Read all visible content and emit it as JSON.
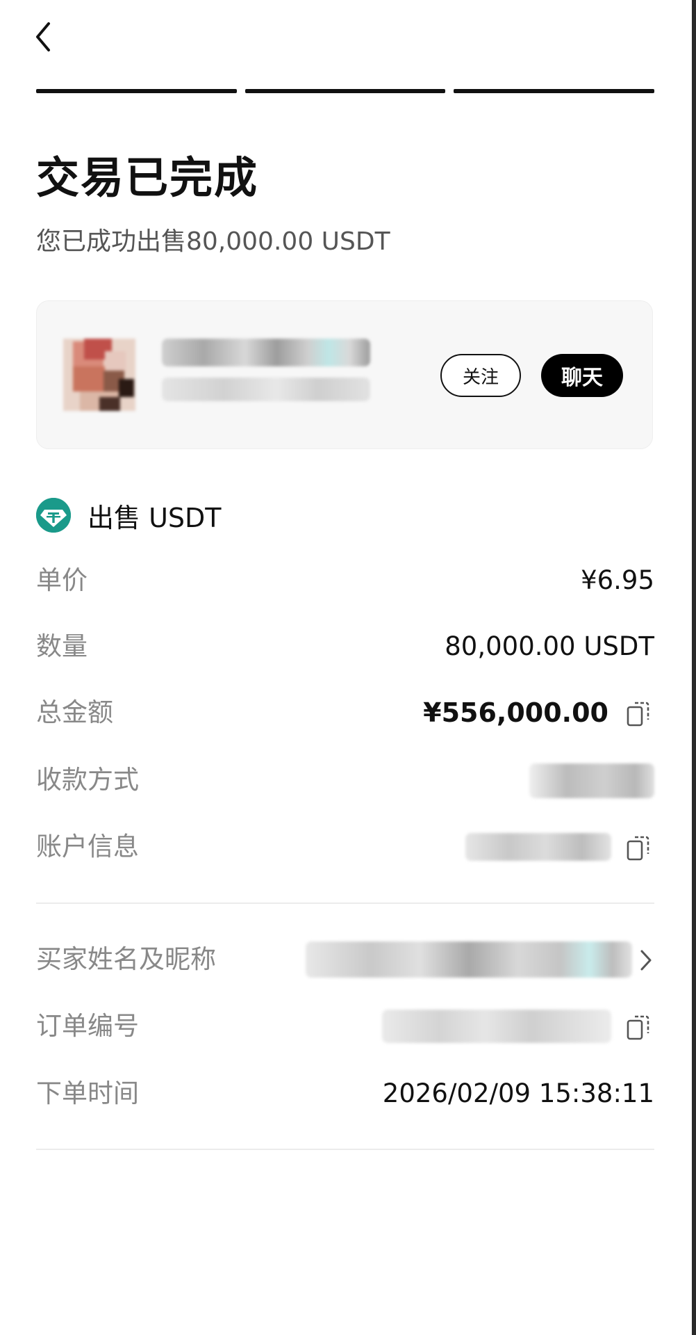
{
  "header": {
    "back_icon": "chevron-left-icon",
    "progress_steps": 3,
    "progress_completed": 3
  },
  "status": {
    "title": "交易已完成",
    "subtitle": "您已成功出售80,000.00 USDT"
  },
  "counterparty": {
    "follow_label": "关注",
    "chat_label": "聊天"
  },
  "trade": {
    "coin_icon": "tether-icon",
    "heading": "出售 USDT"
  },
  "details": {
    "unit_price": {
      "label": "单价",
      "value": "¥6.95"
    },
    "quantity": {
      "label": "数量",
      "value": "80,000.00 USDT"
    },
    "total": {
      "label": "总金额",
      "value": "¥556,000.00"
    },
    "payment_method": {
      "label": "收款方式"
    },
    "account_info": {
      "label": "账户信息"
    }
  },
  "order": {
    "buyer": {
      "label": "买家姓名及昵称"
    },
    "order_number": {
      "label": "订单编号"
    },
    "order_time": {
      "label": "下单时间",
      "value": "2026/02/09 15:38:11"
    }
  },
  "colors": {
    "accent": "#000000",
    "coin": "#1a9a8a",
    "muted_text": "#888888"
  }
}
